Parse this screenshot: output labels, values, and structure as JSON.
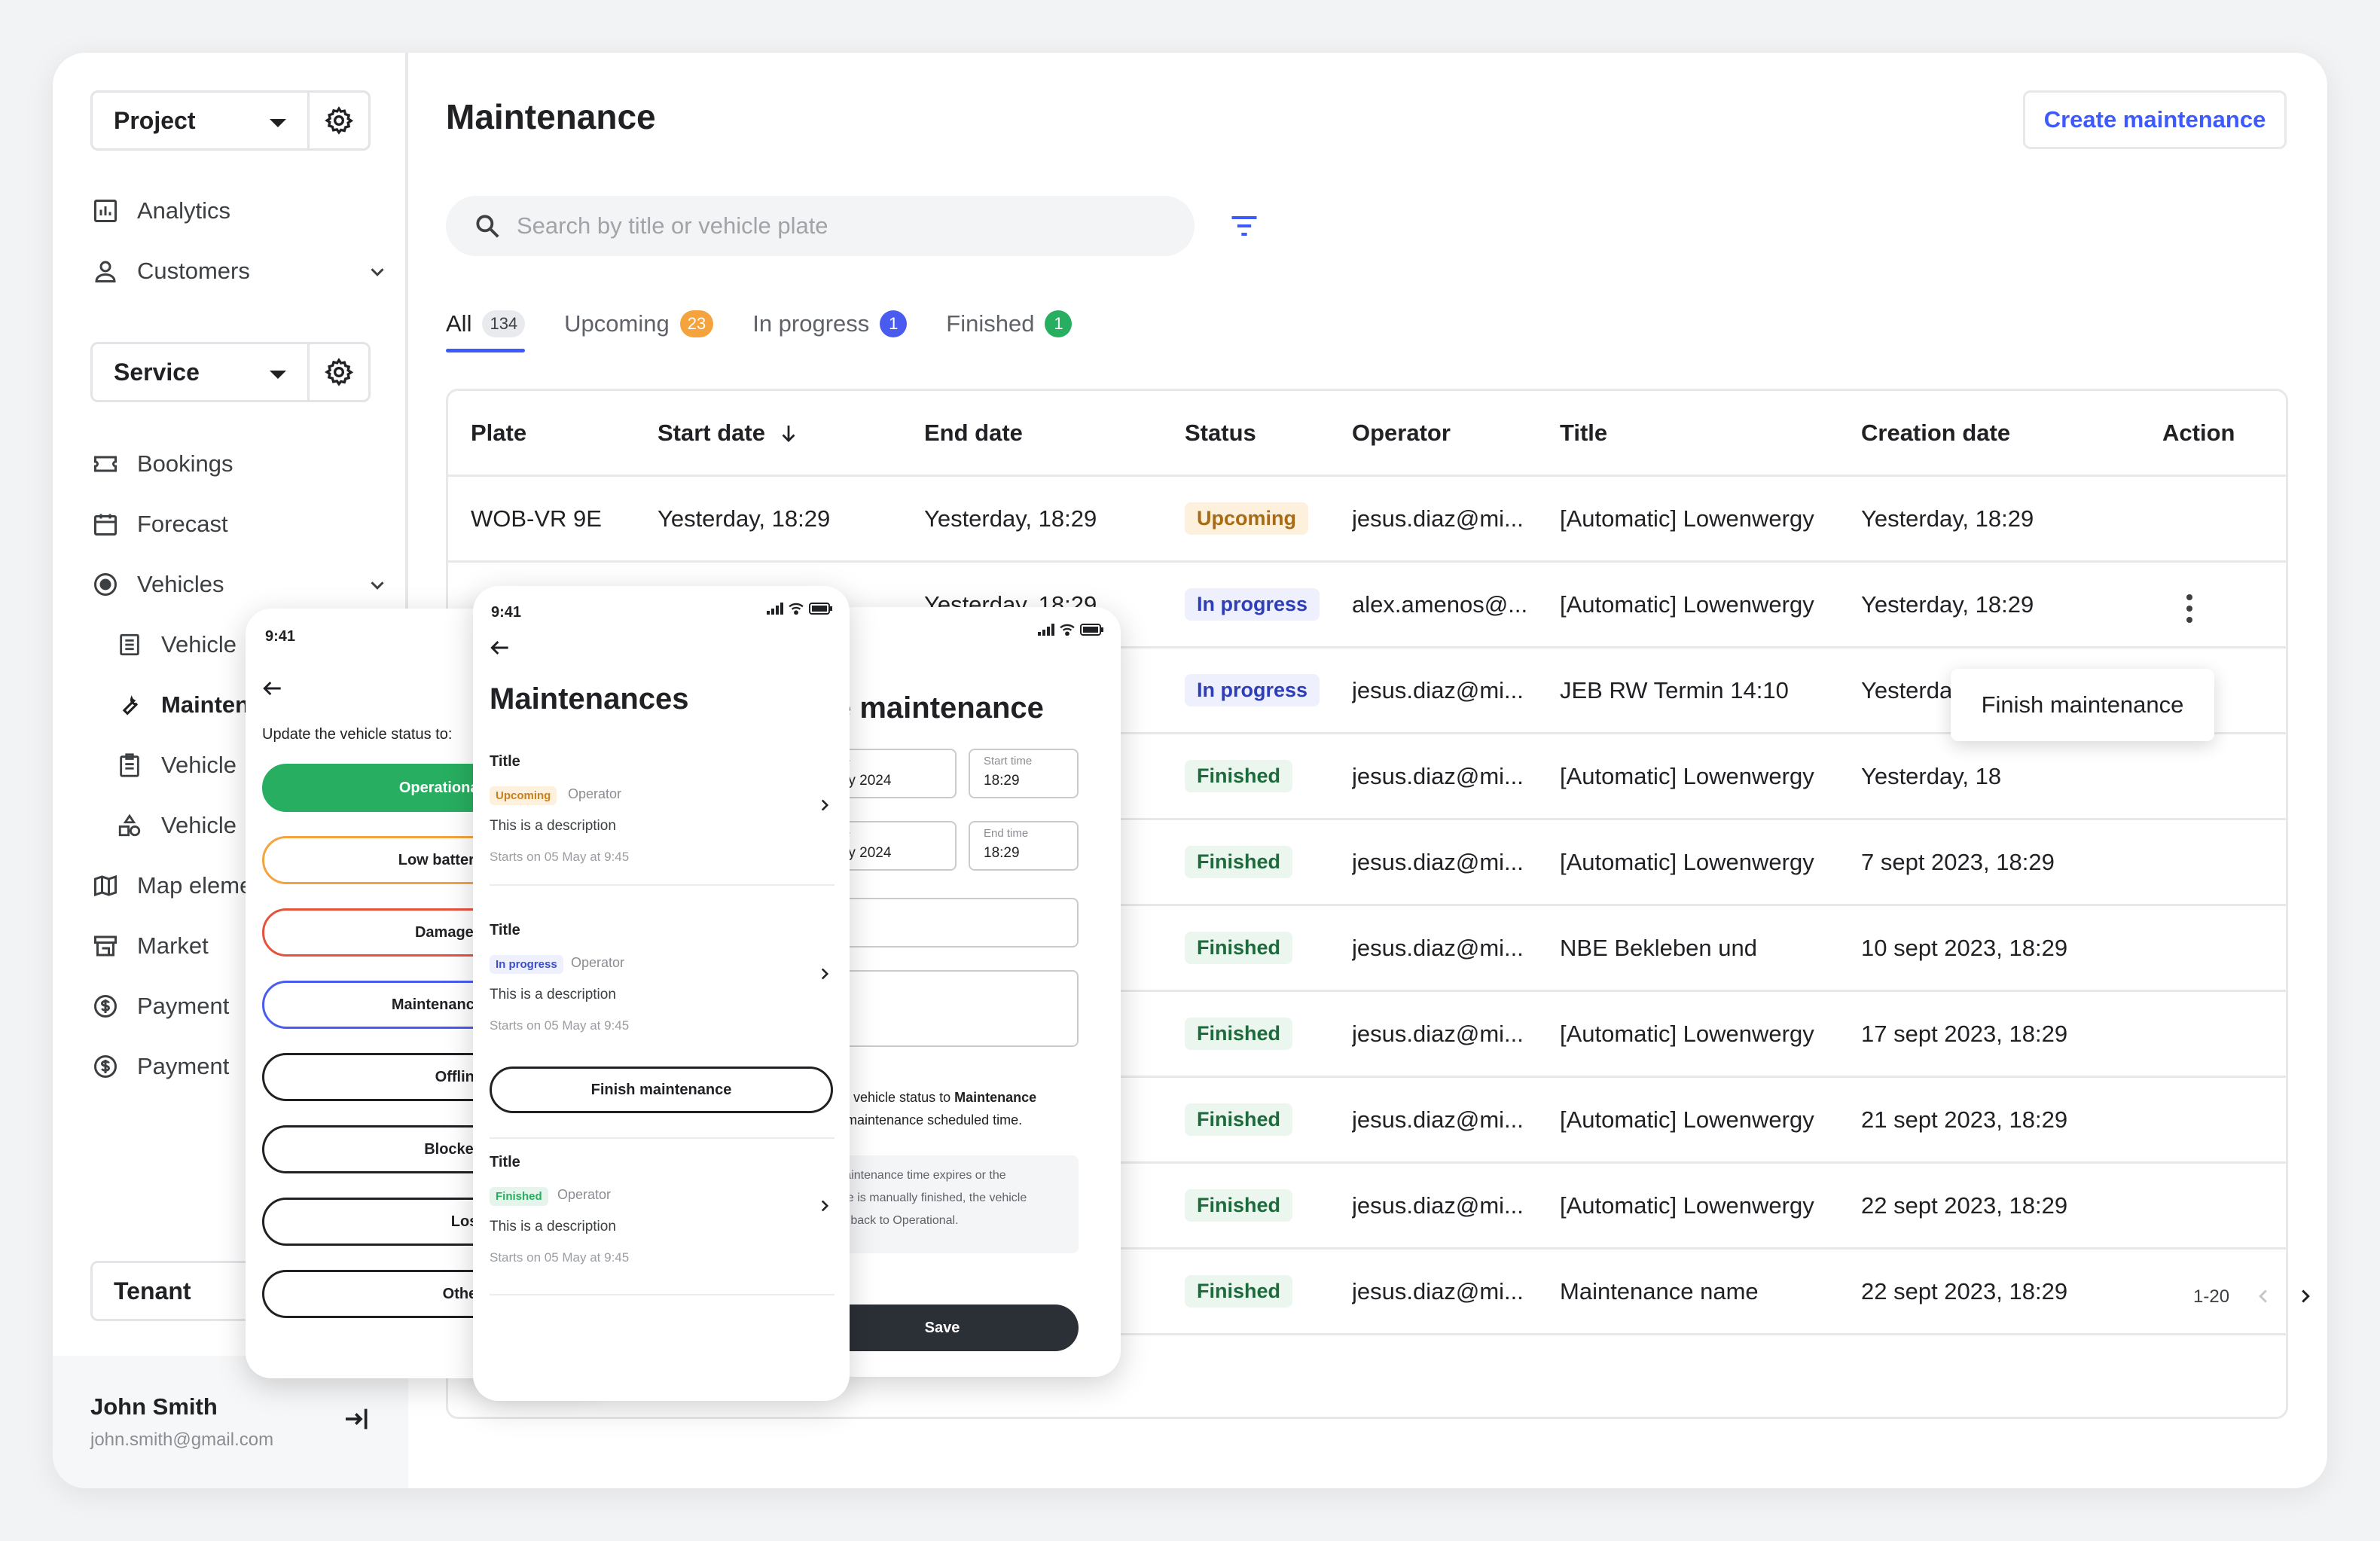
{
  "sidebar": {
    "project_label": "Project",
    "service_label": "Service",
    "tenant_label": "Tenant",
    "items_top": [
      {
        "label": "Analytics",
        "icon": "analytics-icon"
      },
      {
        "label": "Customers",
        "icon": "user-icon"
      }
    ],
    "items_service": [
      {
        "label": "Bookings",
        "icon": "ticket-icon"
      },
      {
        "label": "Forecast",
        "icon": "calendar-icon"
      },
      {
        "label": "Vehicles",
        "icon": "vehicle-circle-icon"
      }
    ],
    "sub_items": [
      {
        "label": "Vehicle"
      },
      {
        "label": "Maintenance"
      },
      {
        "label": "Vehicle"
      },
      {
        "label": "Vehicle"
      }
    ],
    "items_bottom": [
      {
        "label": "Map elements"
      },
      {
        "label": "Market"
      },
      {
        "label": "Payment"
      },
      {
        "label": "Payment"
      }
    ],
    "user": {
      "name": "John Smith",
      "email": "john.smith@gmail.com"
    }
  },
  "header": {
    "title": "Maintenance",
    "create_label": "Create maintenance"
  },
  "search": {
    "placeholder": "Search by title or vehicle plate"
  },
  "tabs": [
    {
      "label": "All",
      "count": "134",
      "color": "#e8eaed"
    },
    {
      "label": "Upcoming",
      "count": "23",
      "color": "#f5a33d"
    },
    {
      "label": "In progress",
      "count": "1",
      "color": "#4a5cf0"
    },
    {
      "label": "Finished",
      "count": "1",
      "color": "#27ae60"
    }
  ],
  "table": {
    "columns": [
      "Plate",
      "Start date",
      "End date",
      "Status",
      "Operator",
      "Title",
      "Creation date",
      "Action"
    ],
    "rows": [
      {
        "plate": "WOB-VR 9E",
        "start": "Yesterday, 18:29",
        "end": "Yesterday, 18:29",
        "status": "Upcoming",
        "operator": "jesus.diaz@mi...",
        "title": "[Automatic] Lowenwergy",
        "created": "Yesterday, 18:29",
        "action": false
      },
      {
        "plate": "",
        "start": "",
        "end": "Yesterday, 18:29",
        "status": "In progress",
        "operator": "alex.amenos@...",
        "title": "[Automatic] Lowenwergy",
        "created": "Yesterday, 18:29",
        "action": true
      },
      {
        "plate": "",
        "start": "",
        "end": "",
        "status": "In progress",
        "operator": "jesus.diaz@mi...",
        "title": "JEB RW Termin 14:10",
        "created": "Yesterday, 18:29",
        "action": true
      },
      {
        "plate": "",
        "start": "",
        "end": "",
        "status": "Finished",
        "operator": "jesus.diaz@mi...",
        "title": "[Automatic] Lowenwergy",
        "created": "Yesterday, 18",
        "action": false
      },
      {
        "plate": "",
        "start": "",
        "end": "9",
        "status": "Finished",
        "operator": "jesus.diaz@mi...",
        "title": "[Automatic] Lowenwergy",
        "created": "7 sept 2023, 18:29",
        "action": false
      },
      {
        "plate": "",
        "start": "",
        "end": "29",
        "status": "Finished",
        "operator": "jesus.diaz@mi...",
        "title": "NBE Bekleben und",
        "created": "10 sept 2023, 18:29",
        "action": false
      },
      {
        "plate": "",
        "start": "",
        "end": "29",
        "status": "Finished",
        "operator": "jesus.diaz@mi...",
        "title": "[Automatic] Lowenwergy",
        "created": "17 sept 2023, 18:29",
        "action": false
      },
      {
        "plate": "",
        "start": "",
        "end": "29",
        "status": "Finished",
        "operator": "jesus.diaz@mi...",
        "title": "[Automatic] Lowenwergy",
        "created": "21 sept 2023, 18:29",
        "action": false
      },
      {
        "plate": "",
        "start": "",
        "end": "29",
        "status": "Finished",
        "operator": "jesus.diaz@mi...",
        "title": "[Automatic] Lowenwergy",
        "created": "22 sept 2023, 18:29",
        "action": false
      },
      {
        "plate": "",
        "start": "",
        "end": "29",
        "status": "Finished",
        "operator": "jesus.diaz@mi...",
        "title": "Maintenance name",
        "created": "22 sept 2023, 18:29",
        "action": false
      }
    ],
    "status_colors": {
      "Upcoming": {
        "bg": "#fdf0dc",
        "fg": "#a86a12"
      },
      "In progress": {
        "bg": "#eef0fd",
        "fg": "#2e3db8"
      },
      "Finished": {
        "bg": "#eaf6ee",
        "fg": "#1d6b3c"
      }
    }
  },
  "context_menu": {
    "label": "Finish maintenance"
  },
  "pagination": {
    "range": "1-20"
  },
  "phone_status": {
    "time": "9:41",
    "prompt": "Update the vehicle status to:",
    "options": [
      {
        "label": "Operational",
        "border": "#27ae60",
        "fill": "#27ae60",
        "fg": "#ffffff"
      },
      {
        "label": "Low battery",
        "border": "#f5a33d",
        "fill": "#ffffff",
        "fg": "#202124"
      },
      {
        "label": "Damaged",
        "border": "#e5533d",
        "fill": "#ffffff",
        "fg": "#202124"
      },
      {
        "label": "Maintenance",
        "border": "#4a5cf0",
        "fill": "#ffffff",
        "fg": "#202124"
      },
      {
        "label": "Offline",
        "border": "#202124",
        "fill": "#ffffff",
        "fg": "#202124"
      },
      {
        "label": "Blocked",
        "border": "#202124",
        "fill": "#ffffff",
        "fg": "#202124"
      },
      {
        "label": "Lost",
        "border": "#202124",
        "fill": "#ffffff",
        "fg": "#202124"
      },
      {
        "label": "Other",
        "border": "#202124",
        "fill": "#ffffff",
        "fg": "#202124"
      }
    ]
  },
  "phone_list": {
    "time": "9:41",
    "title": "Maintenances",
    "items": [
      {
        "title": "Title",
        "status": "Upcoming",
        "operator": "Operator",
        "desc": "This is a description",
        "start": "Starts on 05 May at 9:45"
      },
      {
        "title": "Title",
        "status": "In progress",
        "operator": "Operator",
        "desc": "This is a description",
        "start": "Starts on 05 May at 9:45"
      },
      {
        "title": "Title",
        "status": "Finished",
        "operator": "Operator",
        "desc": "This is a description",
        "start": "Starts on 05 May at 9:45"
      }
    ],
    "finish_label": "Finish maintenance"
  },
  "phone_create": {
    "title_partial": "e maintenance",
    "start_date_label": "date",
    "start_date_value": "May 2024",
    "start_time_label": "Start time",
    "start_time_value": "18:29",
    "end_date_label": "date",
    "end_date_value": "May 2024",
    "end_time_label": "End time",
    "end_time_value": "18:29",
    "info1_prefix": "ge vehicle status to ",
    "info1_bold": "Maintenance",
    "info1_line2": "g maintenance scheduled time.",
    "info2_l1": "maintenance time expires or the",
    "info2_l2": "nce is manually finished, the vehicle",
    "info2_l3": "es back to Operational.",
    "save_label": "Save"
  }
}
